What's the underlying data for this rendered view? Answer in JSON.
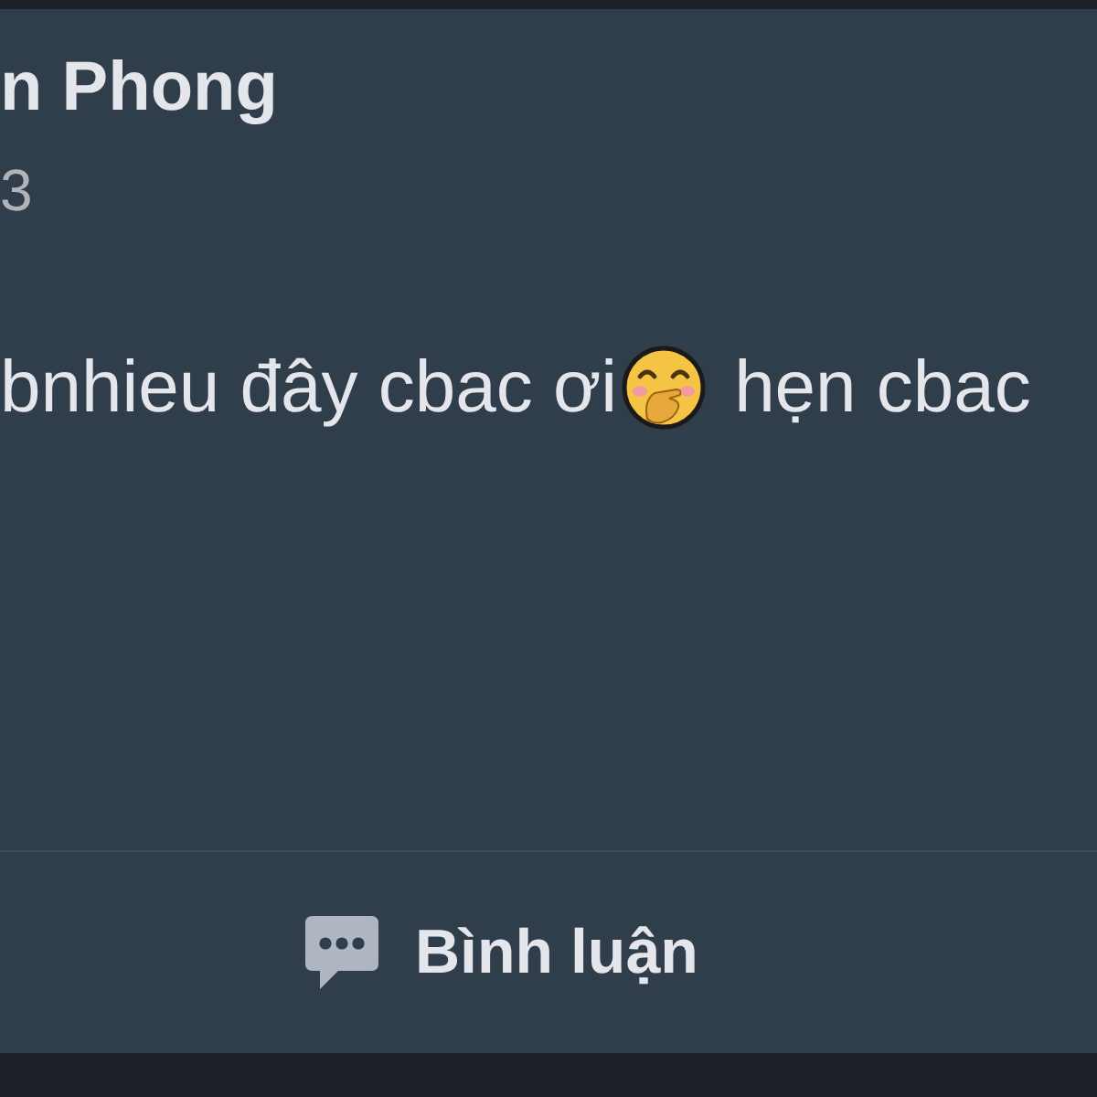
{
  "post": {
    "author": "n Phong",
    "timestamp": "3",
    "text": [
      {
        "kind": "text",
        "value": "bnhieu đây cbac ơi"
      },
      {
        "kind": "emoji"
      },
      {
        "kind": "text",
        "value": "hẹn cbac"
      }
    ]
  },
  "actions": [
    {
      "kind": "comment",
      "label": "Bình luận"
    }
  ]
}
